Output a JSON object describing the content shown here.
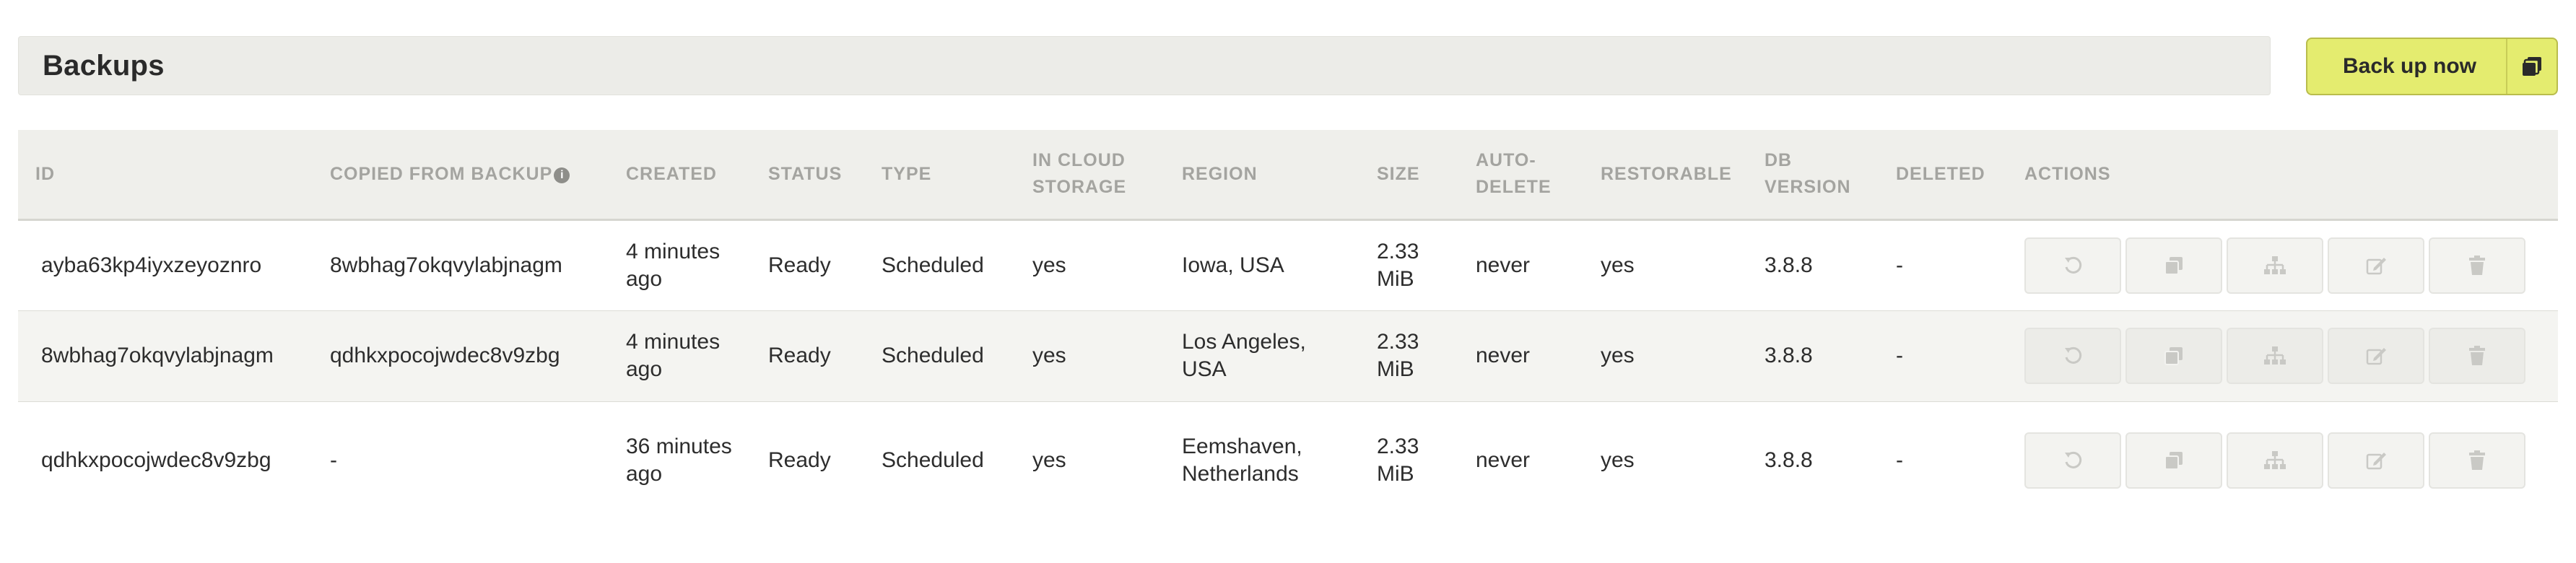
{
  "header": {
    "title": "Backups"
  },
  "toolbar": {
    "backup_now_label": "Back up now",
    "backup_icon": "copy-stack-icon"
  },
  "table": {
    "columns": {
      "id": "ID",
      "copied_from": "COPIED FROM BACKUP",
      "created": "CREATED",
      "status": "STATUS",
      "type": "TYPE",
      "in_cloud": "IN CLOUD STORAGE",
      "region": "REGION",
      "size": "SIZE",
      "auto_delete": "AUTO-DELETE",
      "restorable": "RESTORABLE",
      "db_version": "DB VERSION",
      "deleted": "DELETED",
      "actions": "ACTIONS"
    },
    "info_icon": "info-icon",
    "rows": [
      {
        "id": "ayba63kp4iyxzeyoznro",
        "copied_from": "8wbhag7okqvylabjnagm",
        "created": "4 minutes ago",
        "status": "Ready",
        "type": "Scheduled",
        "in_cloud": "yes",
        "region": "Iowa, USA",
        "size": "2.33 MiB",
        "auto_delete": "never",
        "restorable": "yes",
        "db_version": "3.8.8",
        "deleted": "-"
      },
      {
        "id": "8wbhag7okqvylabjnagm",
        "copied_from": "qdhkxpocojwdec8v9zbg",
        "created": "4 minutes ago",
        "status": "Ready",
        "type": "Scheduled",
        "in_cloud": "yes",
        "region": "Los Angeles, USA",
        "size": "2.33 MiB",
        "auto_delete": "never",
        "restorable": "yes",
        "db_version": "3.8.8",
        "deleted": "-"
      },
      {
        "id": "qdhkxpocojwdec8v9zbg",
        "copied_from": "-",
        "created": "36 minutes ago",
        "status": "Ready",
        "type": "Scheduled",
        "in_cloud": "yes",
        "region": "Eemshaven, Netherlands",
        "size": "2.33 MiB",
        "auto_delete": "never",
        "restorable": "yes",
        "db_version": "3.8.8",
        "deleted": "-"
      }
    ],
    "action_icons": [
      "restore-icon",
      "copy-icon",
      "hierarchy-icon",
      "edit-icon",
      "trash-icon"
    ],
    "colors": {
      "icon_disabled": "#c9c9c5",
      "button_accent": "#e4ec6f"
    }
  }
}
